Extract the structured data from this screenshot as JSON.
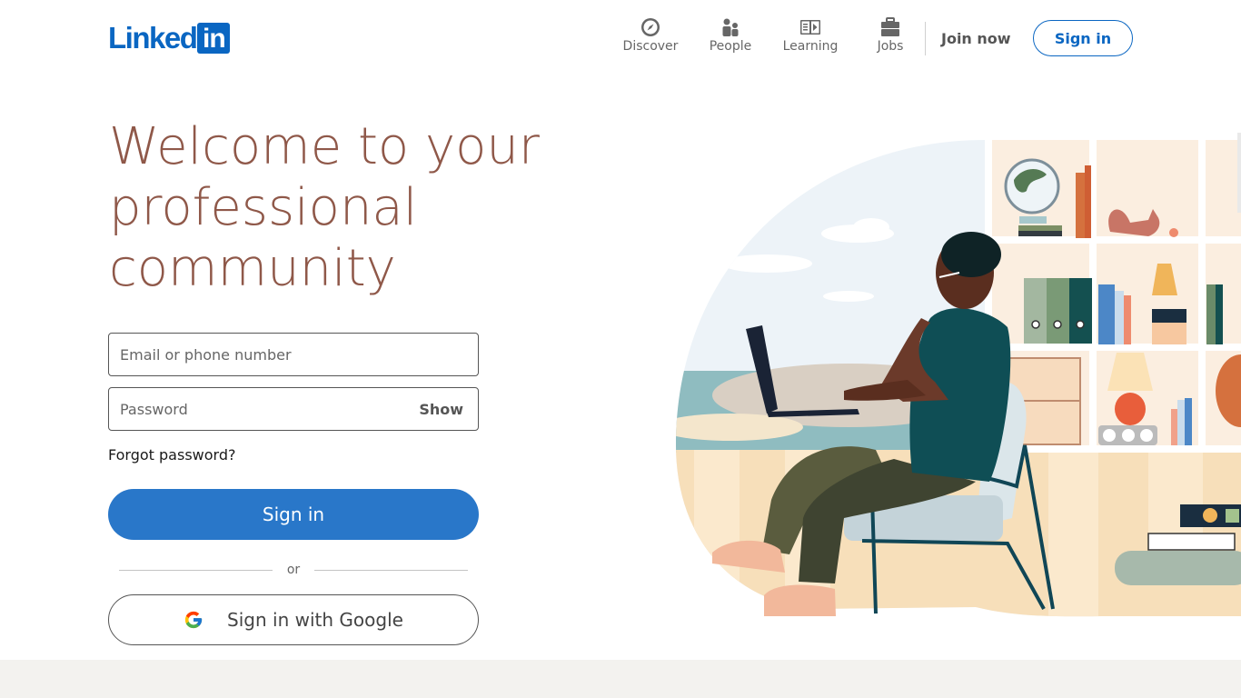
{
  "brand": {
    "logo_text": "Linked",
    "logo_box": "in",
    "accent": "#0a66c2"
  },
  "nav": {
    "items": [
      {
        "label": "Discover",
        "icon": "compass-icon"
      },
      {
        "label": "People",
        "icon": "people-icon"
      },
      {
        "label": "Learning",
        "icon": "learning-icon"
      },
      {
        "label": "Jobs",
        "icon": "briefcase-icon"
      }
    ],
    "join_now": "Join now",
    "sign_in": "Sign in"
  },
  "hero": {
    "headline": "Welcome to your professional community",
    "headline_color": "#8f5849"
  },
  "form": {
    "email_placeholder": "Email or phone number",
    "password_placeholder": "Password",
    "show_label": "Show",
    "forgot_password": "Forgot password?",
    "sign_in_button": "Sign in",
    "or_text": "or",
    "google_button": "Sign in with Google",
    "primary_color": "#2977c9"
  },
  "illustration": {
    "icon": "person-with-laptop-illustration"
  }
}
